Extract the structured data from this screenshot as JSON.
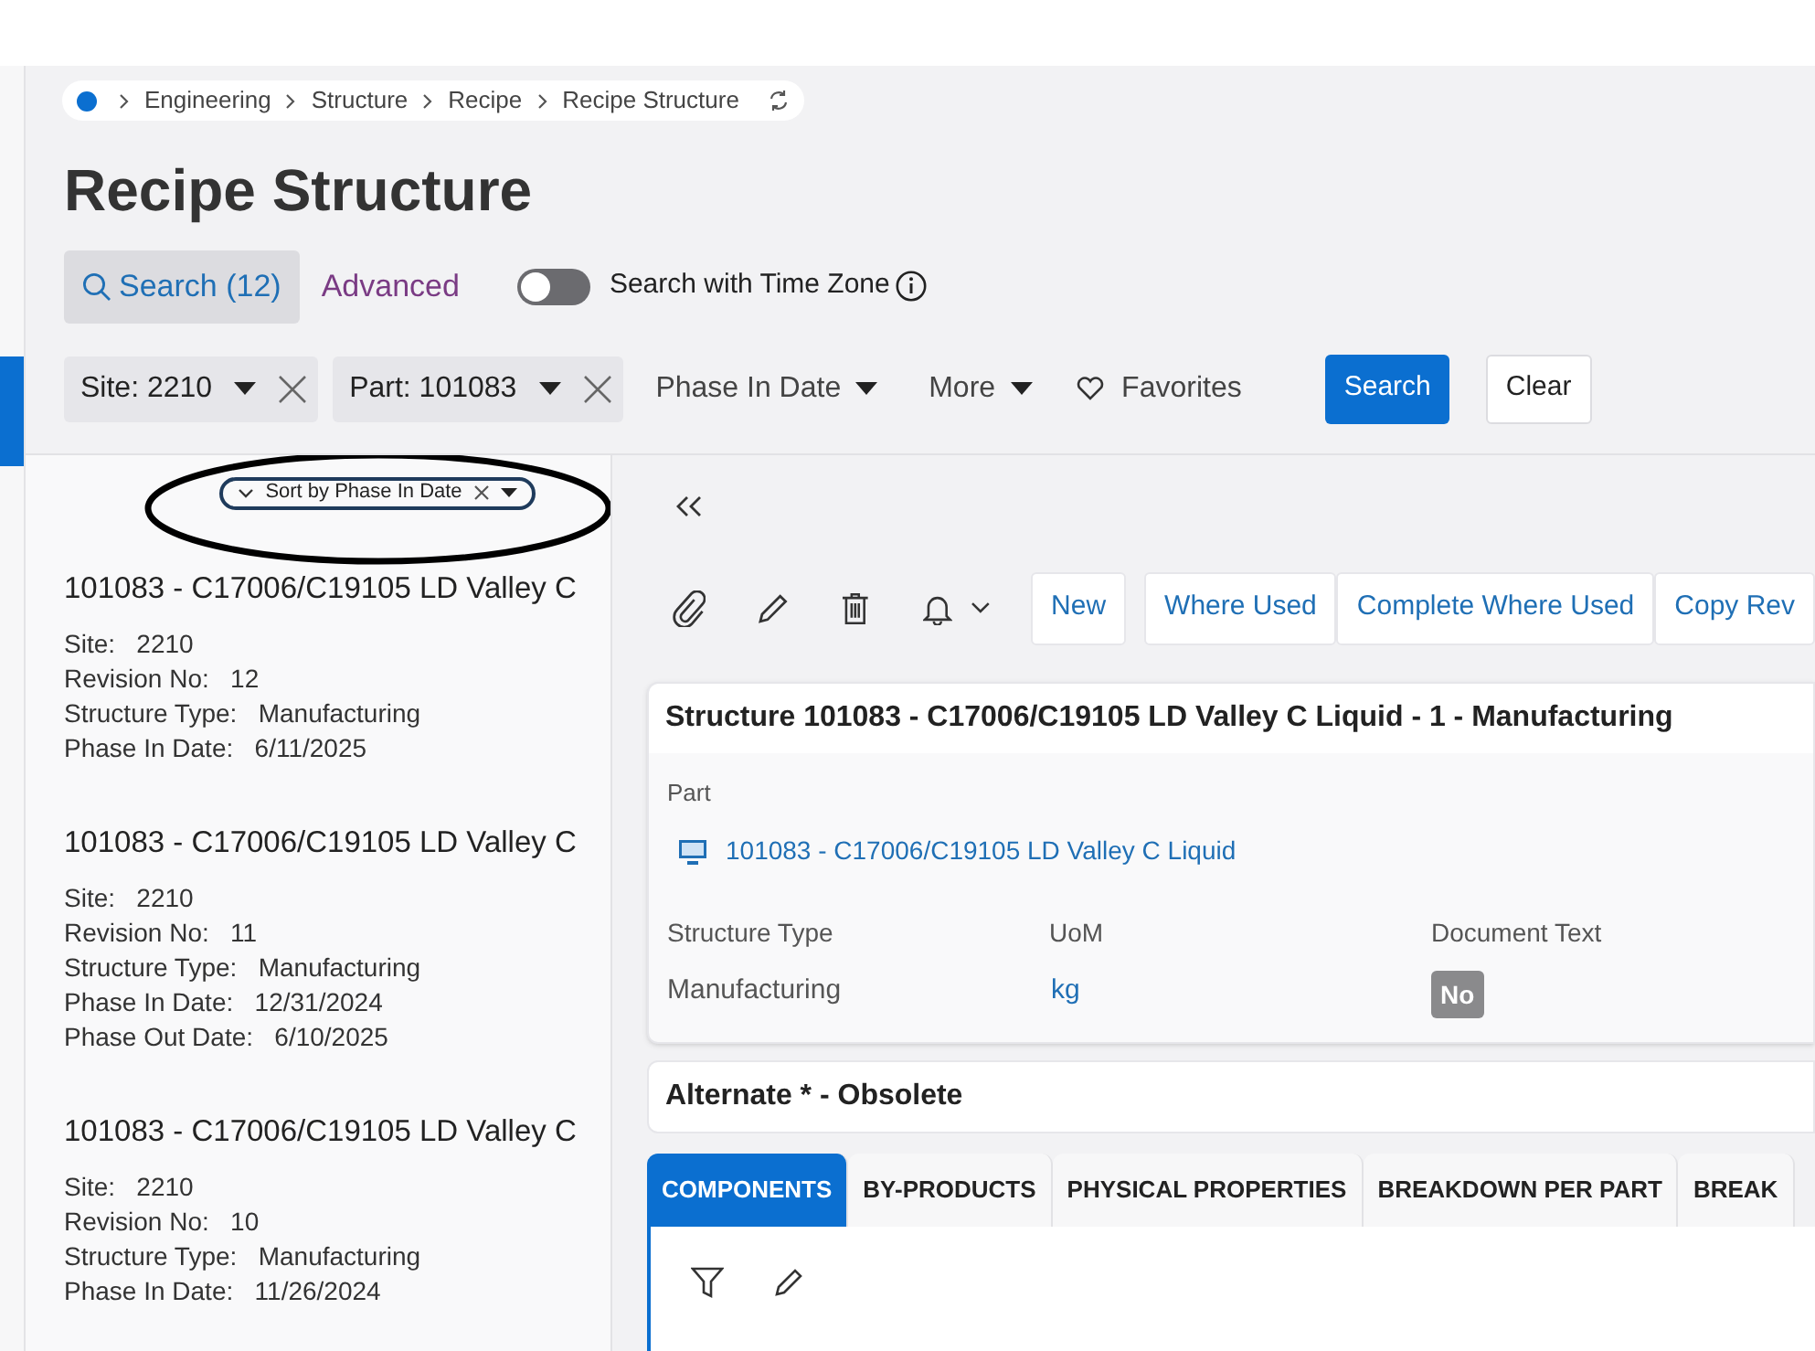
{
  "breadcrumb": [
    "Engineering",
    "Structure",
    "Recipe",
    "Recipe Structure"
  ],
  "page_title": "Recipe Structure",
  "search_tabs": [
    {
      "label": "Search (12)",
      "selected": true
    },
    {
      "label": "Advanced",
      "selected": false
    }
  ],
  "time_zone_toggle": {
    "label": "Search with Time Zone",
    "on": false
  },
  "filters": [
    {
      "label": "Site: 2210",
      "kind": "chip"
    },
    {
      "label": "Part: 101083",
      "kind": "chip"
    },
    {
      "label": "Phase In Date",
      "kind": "dropdown"
    },
    {
      "label": "More",
      "kind": "dropdown"
    },
    {
      "label": "Favorites",
      "kind": "favorites"
    }
  ],
  "buttons": [
    {
      "label": "Search",
      "kind": "primary"
    },
    {
      "label": "Clear",
      "kind": "secondary"
    }
  ],
  "sort_chip": "Sort by Phase In Date",
  "records": [
    {
      "title": "101083 - C17006/C19105 LD Valley C",
      "fields": [
        {
          "label": "Site:",
          "value": "2210"
        },
        {
          "label": "Revision No:",
          "value": "12"
        },
        {
          "label": "Structure Type:",
          "value": "Manufacturing"
        },
        {
          "label": "Phase In Date:",
          "value": "6/11/2025"
        }
      ]
    },
    {
      "title": "101083 - C17006/C19105 LD Valley C",
      "fields": [
        {
          "label": "Site:",
          "value": "2210"
        },
        {
          "label": "Revision No:",
          "value": "11"
        },
        {
          "label": "Structure Type:",
          "value": "Manufacturing"
        },
        {
          "label": "Phase In Date:",
          "value": "12/31/2024"
        },
        {
          "label": "Phase Out Date:",
          "value": "6/10/2025"
        }
      ]
    },
    {
      "title": "101083 - C17006/C19105 LD Valley C",
      "fields": [
        {
          "label": "Site:",
          "value": "2210"
        },
        {
          "label": "Revision No:",
          "value": "10"
        },
        {
          "label": "Structure Type:",
          "value": "Manufacturing"
        },
        {
          "label": "Phase In Date:",
          "value": "11/26/2024"
        }
      ]
    }
  ],
  "toolbar_buttons": [
    "New",
    "Where Used",
    "Complete Where Used",
    "Copy Rev"
  ],
  "structure_card": {
    "title": "Structure 101083 - C17006/C19105 LD Valley C Liquid - 1 - Manufacturing",
    "part_label": "Part",
    "part_value": "101083 - C17006/C19105 LD Valley C Liquid",
    "fields": [
      {
        "label": "Structure Type",
        "value": "Manufacturing",
        "kind": "text"
      },
      {
        "label": "UoM",
        "value": "kg",
        "kind": "link"
      },
      {
        "label": "Document Text",
        "value": "No",
        "kind": "badge"
      }
    ]
  },
  "alternate_title": "Alternate * - Obsolete",
  "detail_tabs": [
    {
      "label": "COMPONENTS",
      "selected": true
    },
    {
      "label": "BY-PRODUCTS",
      "selected": false
    },
    {
      "label": "PHYSICAL PROPERTIES",
      "selected": false
    },
    {
      "label": "BREAKDOWN PER PART",
      "selected": false
    },
    {
      "label": "BREAK",
      "selected": false
    }
  ]
}
